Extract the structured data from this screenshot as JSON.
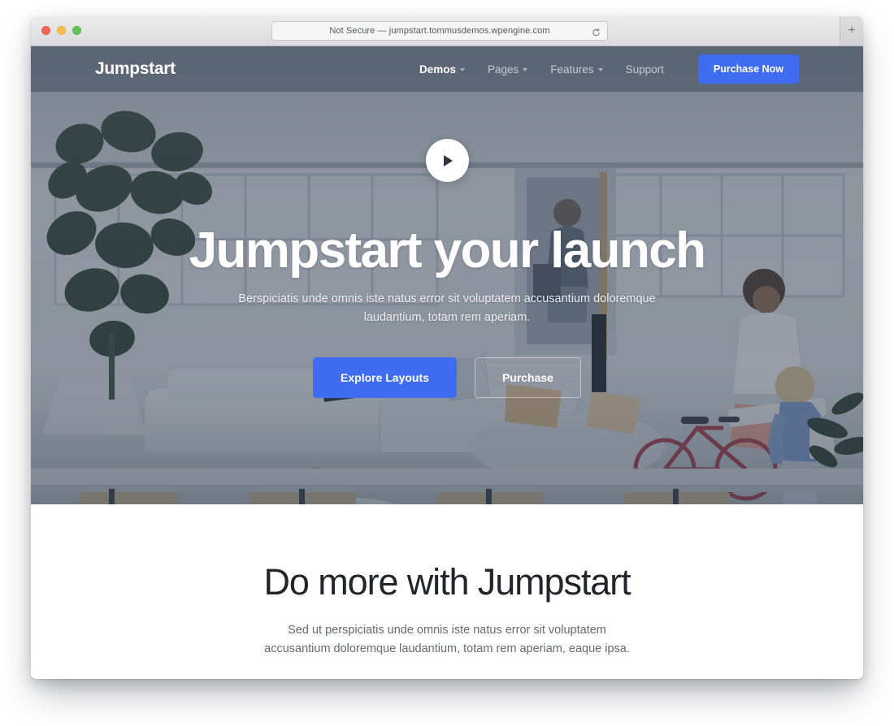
{
  "browser": {
    "url_text": "Not Secure — jumpstart.tommusdemos.wpengine.com",
    "reload_icon": "reload-icon",
    "new_tab_label": "+",
    "traffic_lights": [
      "close",
      "minimize",
      "maximize"
    ]
  },
  "site": {
    "brand": "Jumpstart",
    "nav_items": [
      {
        "label": "Demos",
        "has_caret": true,
        "active": true
      },
      {
        "label": "Pages",
        "has_caret": true,
        "active": false
      },
      {
        "label": "Features",
        "has_caret": true,
        "active": false
      },
      {
        "label": "Support",
        "has_caret": false,
        "active": false
      }
    ],
    "nav_cta": "Purchase Now"
  },
  "hero": {
    "play_icon": "play-icon",
    "title": "Jumpstart your launch",
    "subtitle": "Berspiciatis unde omnis iste natus error sit voluptatem accusantium doloremque laudantium, totam rem aperiam.",
    "primary_cta": "Explore Layouts",
    "secondary_cta": "Purchase"
  },
  "more_section": {
    "title": "Do more with Jumpstart",
    "subtitle": "Sed ut perspiciatis unde omnis iste natus error sit voluptatem accusantium doloremque laudantium, totam rem aperiam, eaque ipsa."
  },
  "colors": {
    "accent_blue": "#3f6cf0",
    "hero_overlay": "#3e4858",
    "nav_bar": "#4b5768",
    "heading_dark": "#22262b",
    "body_text": "#636a72"
  }
}
